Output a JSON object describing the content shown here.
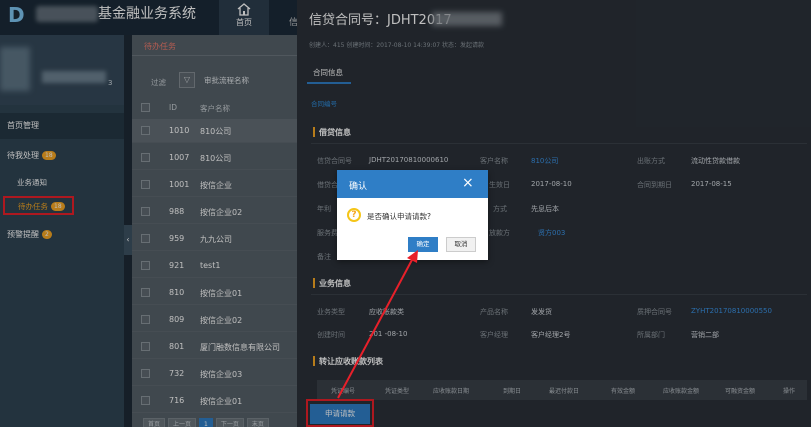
{
  "app": {
    "title_visible": "基金融业务系统",
    "logo_glyph": "D"
  },
  "topnav": {
    "home_label": "首页",
    "cut_label": "信"
  },
  "user": {
    "name_tail": "3"
  },
  "sidebar": {
    "home": "首页管理",
    "pending": {
      "label": "待我处理",
      "badge": "18"
    },
    "notice": "业务通知",
    "todo": {
      "label": "待办任务",
      "badge": "18"
    },
    "warning": {
      "label": "预警提醒",
      "badge": "2"
    },
    "collapse_glyph": "‹"
  },
  "midpanel": {
    "tab": "待办任务",
    "filter_label": "过滤",
    "filter_field": "审批流程名称",
    "headers": {
      "id": "ID",
      "name": "客户名称"
    },
    "rows": [
      {
        "id": "1010",
        "name": "810公司"
      },
      {
        "id": "1007",
        "name": "810公司"
      },
      {
        "id": "1001",
        "name": "按信企业"
      },
      {
        "id": "988",
        "name": "按信企业02"
      },
      {
        "id": "959",
        "name": "九九公司"
      },
      {
        "id": "921",
        "name": "test1"
      },
      {
        "id": "810",
        "name": "按信企业01"
      },
      {
        "id": "809",
        "name": "按信企业02"
      },
      {
        "id": "801",
        "name": "厦门融数信息有限公司"
      },
      {
        "id": "732",
        "name": "按信企业03"
      },
      {
        "id": "716",
        "name": "按信企业01"
      }
    ],
    "pager": {
      "first": "首页",
      "prev": "上一页",
      "current": "1",
      "next": "下一页",
      "last": "末页"
    }
  },
  "detail": {
    "title": "信贷合同号：JDHT2017",
    "meta": "创建人：415    创建时间：2017-08-10 14:39:07    状态：发起请款",
    "tab": "合同信息",
    "subtab": "合同编号",
    "section_credit": "借贷信息",
    "credit_fields": {
      "contract_no_label": "信贷合同号",
      "contract_no": "JDHT20170810000610",
      "customer_label": "客户名称",
      "customer": "810公司",
      "payout_label": "出账方式",
      "payout": "流动性贷款借款",
      "row2_label1": "借贷合",
      "effective_label": "生效日",
      "effective": "2017-08-10",
      "expire_label": "合同到期日",
      "expire": "2017-08-15",
      "row3_label1": "年利",
      "repay_label": "方式",
      "repay": "先息后本",
      "row4_label1": "服务费",
      "lender_label": "放款方",
      "lender": "贤方003",
      "remark_label": "备注"
    },
    "section_business": "业务信息",
    "biz_fields": {
      "type_label": "业务类型",
      "type": "应收账款类",
      "product_label": "产品名称",
      "product": "发发货",
      "pledge_label": "质押合同号",
      "pledge": "ZYHT20170810000550",
      "created_label": "创建时间",
      "created": "201 -08-10",
      "manager_label": "客户经理",
      "manager": "客户经理2号",
      "dept_label": "所属部门",
      "dept": "营销二部"
    },
    "section_transfer": "转让应收账款列表",
    "table_headers": [
      "凭证编号",
      "凭证类型",
      "应收账款日期",
      "到期日",
      "最迟付款日",
      "有效金额",
      "应收账款金额",
      "可融资金额",
      "操作"
    ],
    "apply_button": "申请请款"
  },
  "dialog": {
    "title": "确认",
    "close_glyph": "×",
    "icon_glyph": "?",
    "message": "是否确认申请请款?",
    "ok": "确定",
    "cancel": "取消"
  },
  "colors": {
    "primary": "#2f7ec6",
    "highlight": "#e8202a",
    "badge": "#f5a623"
  }
}
